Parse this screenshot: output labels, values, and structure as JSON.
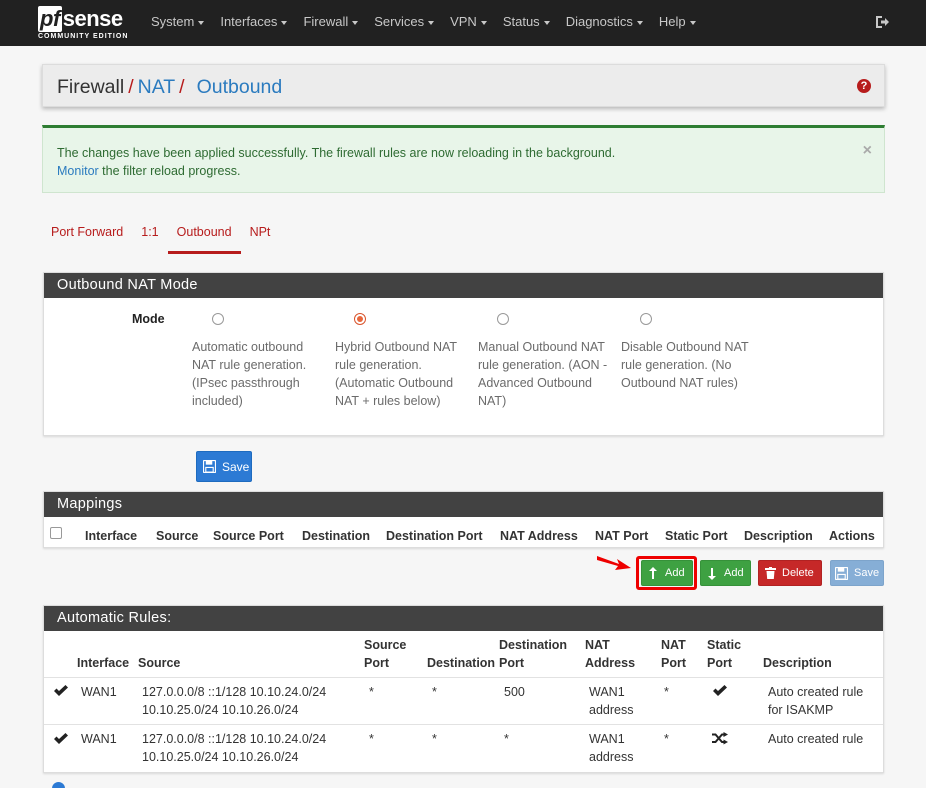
{
  "nav": {
    "logo_pf": "pf",
    "logo_sense": "sense",
    "logo_sub": "COMMUNITY EDITION",
    "items": [
      "System",
      "Interfaces",
      "Firewall",
      "Services",
      "VPN",
      "Status",
      "Diagnostics",
      "Help"
    ]
  },
  "breadcrumb": {
    "root": "Firewall",
    "sep": "/",
    "level2": "NAT",
    "level3": "Outbound"
  },
  "alert": {
    "message": "The changes have been applied successfully. The firewall rules are now reloading in the background.",
    "link": "Monitor",
    "link_suffix": " the filter reload progress.",
    "close": "×"
  },
  "tabs": [
    "Port Forward",
    "1:1",
    "Outbound",
    "NPt"
  ],
  "mode_panel": {
    "title": "Outbound NAT Mode",
    "label": "Mode",
    "options": [
      "Automatic outbound NAT rule generation. (IPsec passthrough included)",
      "Hybrid Outbound NAT rule generation. (Automatic Outbound NAT + rules below)",
      "Manual Outbound NAT rule generation. (AON - Advanced Outbound NAT)",
      "Disable Outbound NAT rule generation. (No Outbound NAT rules)"
    ],
    "selected": 1,
    "save": "Save"
  },
  "mappings": {
    "title": "Mappings",
    "headers": [
      "Interface",
      "Source",
      "Source Port",
      "Destination",
      "Destination Port",
      "NAT Address",
      "NAT Port",
      "Static Port",
      "Description",
      "Actions"
    ],
    "buttons": {
      "add_top": "Add",
      "add_bottom": "Add",
      "delete": "Delete",
      "save": "Save"
    }
  },
  "auto_rules": {
    "title": "Automatic Rules:",
    "headers": {
      "interface": "Interface",
      "source": "Source",
      "source_port_1": "Source",
      "source_port_2": "Port",
      "destination": "Destination",
      "dest_port_1": "Destination",
      "dest_port_2": "Port",
      "nat_addr_1": "NAT",
      "nat_addr_2": "Address",
      "nat_port_1": "NAT",
      "nat_port_2": "Port",
      "static_1": "Static",
      "static_2": "Port",
      "description": "Description"
    },
    "rows": [
      {
        "interface": "WAN1",
        "source_1": "127.0.0.0/8 ::1/128 10.10.24.0/24",
        "source_2": "10.10.25.0/24 10.10.26.0/24",
        "source_port": "*",
        "destination": "*",
        "dest_port": "500",
        "nat_addr_1": "WAN1",
        "nat_addr_2": "address",
        "nat_port": "*",
        "static_icon": "check-icon",
        "desc_1": "Auto created rule",
        "desc_2": "for ISAKMP"
      },
      {
        "interface": "WAN1",
        "source_1": "127.0.0.0/8 ::1/128 10.10.24.0/24",
        "source_2": "10.10.25.0/24 10.10.26.0/24",
        "source_port": "*",
        "destination": "*",
        "dest_port": "*",
        "nat_addr_1": "WAN1",
        "nat_addr_2": "address",
        "nat_port": "*",
        "static_icon": "shuffle-icon",
        "desc_1": "Auto created rule",
        "desc_2": ""
      }
    ]
  },
  "colors": {
    "navbar": "#212121",
    "accent_red": "#b71c1c",
    "link_blue": "#2b7bbf",
    "success_green": "#3ea142"
  }
}
